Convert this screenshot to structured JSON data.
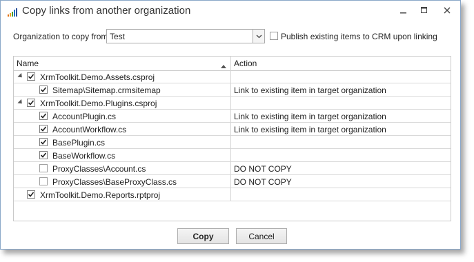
{
  "window": {
    "title": "Copy links from another organization"
  },
  "org": {
    "label": "Organization to copy from:",
    "selected": "Test"
  },
  "publish": {
    "label": "Publish existing items to CRM upon linking",
    "checked": false
  },
  "grid": {
    "columns": [
      "Name",
      "Action"
    ],
    "rows": [
      {
        "name": "XrmToolkit.Demo.Assets.csproj",
        "action": "",
        "level": 0,
        "expander": true,
        "checked": true
      },
      {
        "name": "Sitemap\\Sitemap.crmsitemap",
        "action": "Link to existing item in target organization",
        "level": 1,
        "expander": false,
        "checked": true
      },
      {
        "name": "XrmToolkit.Demo.Plugins.csproj",
        "action": "",
        "level": 0,
        "expander": true,
        "checked": true
      },
      {
        "name": "AccountPlugin.cs",
        "action": "Link to existing item in target organization",
        "level": 1,
        "expander": false,
        "checked": true
      },
      {
        "name": "AccountWorkflow.cs",
        "action": "Link to existing item in target organization",
        "level": 1,
        "expander": false,
        "checked": true
      },
      {
        "name": "BasePlugin.cs",
        "action": "",
        "level": 1,
        "expander": false,
        "checked": true
      },
      {
        "name": "BaseWorkflow.cs",
        "action": "",
        "level": 1,
        "expander": false,
        "checked": true
      },
      {
        "name": "ProxyClasses\\Account.cs",
        "action": "DO NOT COPY",
        "level": 1,
        "expander": false,
        "checked": false
      },
      {
        "name": "ProxyClasses\\BaseProxyClass.cs",
        "action": "DO NOT COPY",
        "level": 1,
        "expander": false,
        "checked": false
      },
      {
        "name": "XrmToolkit.Demo.Reports.rptproj",
        "action": "",
        "level": 0,
        "expander": false,
        "checked": true
      }
    ]
  },
  "buttons": {
    "copy": "Copy",
    "cancel": "Cancel"
  },
  "icons": {
    "app": "bar-chart-icon",
    "minimize": "minimize-icon",
    "maximize": "maximize-icon",
    "close": "close-icon",
    "dropdown": "chevron-down-icon",
    "sort": "sort-ascending-icon"
  }
}
